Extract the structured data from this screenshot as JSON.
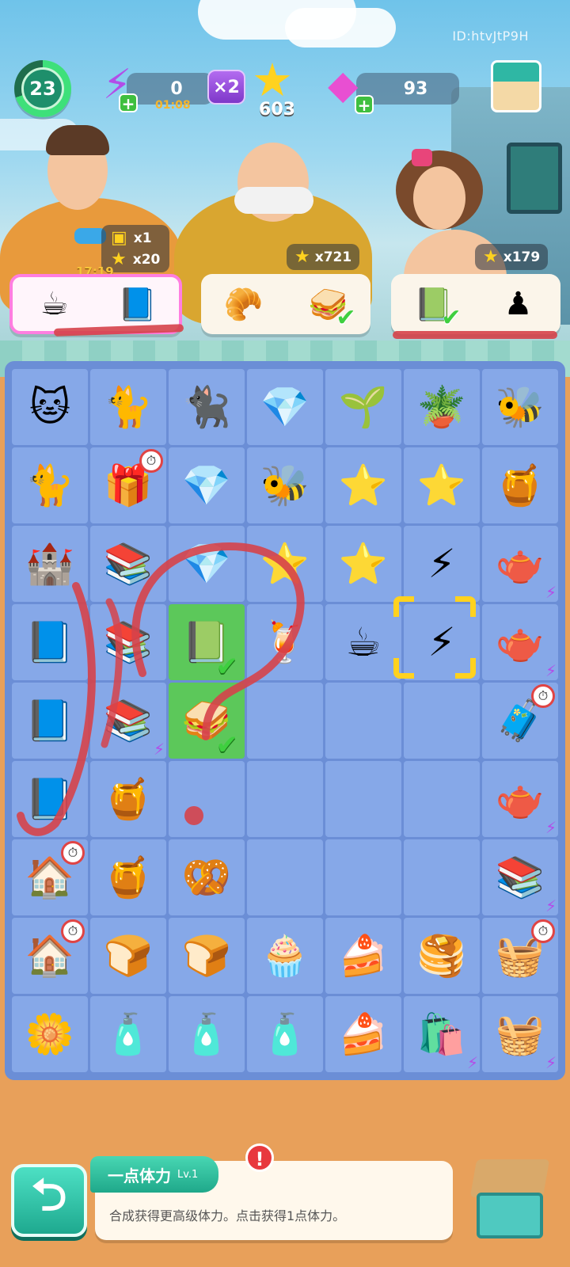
{
  "header": {
    "game_id": "ID:htvJtP9H",
    "level": "23",
    "energy": {
      "value": "0",
      "timer": "01:08",
      "multiplier": "×2"
    },
    "stars": "603",
    "gems": "93"
  },
  "characters": [
    {
      "name": "man",
      "reward_chest": "x1",
      "reward_stars": "x20",
      "countdown": "17:19"
    },
    {
      "name": "old-man",
      "reward_stars": "x721"
    },
    {
      "name": "girl",
      "reward_stars": "x179"
    }
  ],
  "orders": [
    {
      "items": [
        "coffee-cup",
        "storybook"
      ],
      "selected": true
    },
    {
      "items": [
        "croissant",
        "sandwich"
      ],
      "checked": [
        false,
        true
      ]
    },
    {
      "items": [
        "picture-book",
        "chess-board"
      ],
      "checked": [
        true,
        false
      ]
    }
  ],
  "board": {
    "rows": 9,
    "cols": 7,
    "cells": [
      [
        "🐱",
        "🐈",
        "🐈‍⬛",
        "💎",
        "🌱",
        "🪴",
        "🐝"
      ],
      [
        "🐈",
        "🎁",
        "💎",
        "🐝",
        "⭐",
        "⭐",
        "🍯"
      ],
      [
        "🏰",
        "📚",
        "💎",
        "⭐",
        "⭐",
        "⚡",
        "🫖"
      ],
      [
        "📘",
        "📚",
        "📗",
        "🍹",
        "☕",
        "⚡",
        "🫖"
      ],
      [
        "📘",
        "📚",
        "🥪",
        "",
        "",
        "",
        "🧳"
      ],
      [
        "📘",
        "🍯",
        "",
        "",
        "",
        "",
        "🫖"
      ],
      [
        "🏠",
        "🍯",
        "🥨",
        "",
        "",
        "",
        "📚"
      ],
      [
        "🏠",
        "🍞",
        "🍞",
        "🧁",
        "🍰",
        "🥞",
        "🧺"
      ],
      [
        "🌼",
        "🧴",
        "🧴",
        "🧴",
        "🍰",
        "🛍️",
        "🧺"
      ]
    ]
  },
  "bottom": {
    "info_title": "一点体力",
    "info_level": "Lv.1",
    "info_desc": "合成获得更高级体力。点击获得1点体力。",
    "alert": "!"
  }
}
